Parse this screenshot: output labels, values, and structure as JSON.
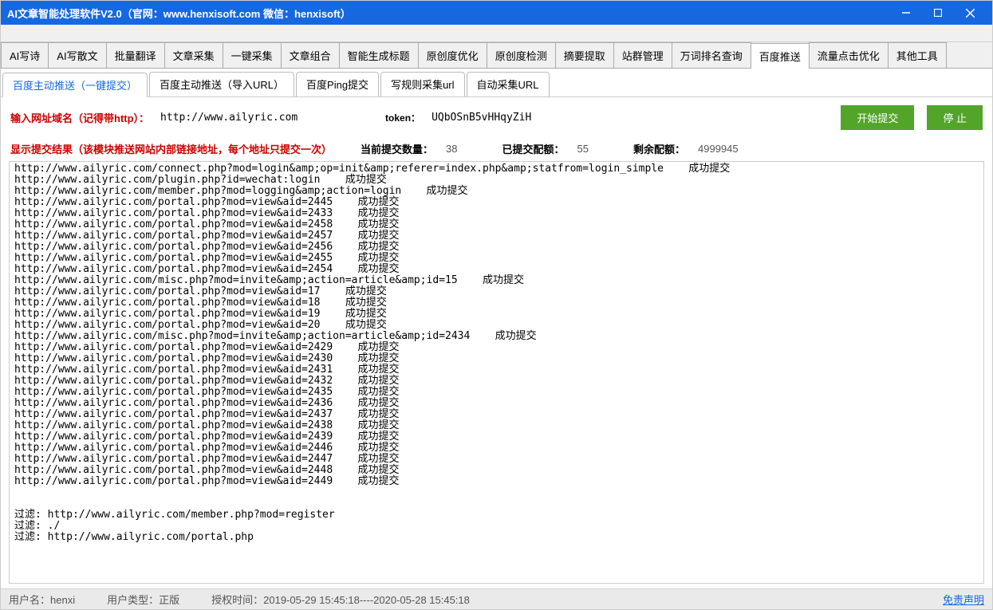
{
  "titlebar": "AI文章智能处理软件V2.0（官网：www.henxisoft.com  微信：henxisoft）",
  "mainTabs": [
    "AI写诗",
    "AI写散文",
    "批量翻译",
    "文章采集",
    "一键采集",
    "文章组合",
    "智能生成标题",
    "原创度优化",
    "原创度检测",
    "摘要提取",
    "站群管理",
    "万词排名查询",
    "百度推送",
    "流量点击优化",
    "其他工具"
  ],
  "mainTabActive": 12,
  "subTabs": [
    "百度主动推送（一键提交）",
    "百度主动推送（导入URL）",
    "百度Ping提交",
    "写规则采集url",
    "自动采集URL"
  ],
  "subTabActive": 0,
  "form": {
    "domainLabel": "输入网址域名（记得带http）：",
    "domainValue": "http://www.ailyric.com",
    "tokenLabel": "token：",
    "tokenValue": "UQbOSnB5vHHqyZiH",
    "startBtn": "开始提交",
    "stopBtn": "停  止"
  },
  "status": {
    "resultLabel": "显示提交结果（该模块推送网站内部链接地址，每个地址只提交一次）",
    "currentLabel": "当前提交数量：",
    "currentVal": "38",
    "submittedLabel": "已提交配额：",
    "submittedVal": "55",
    "remainLabel": "剩余配额：",
    "remainVal": "4999945"
  },
  "log": [
    "http://www.ailyric.com/connect.php?mod=login&amp;op=init&amp;referer=index.php&amp;statfrom=login_simple    成功提交",
    "http://www.ailyric.com/plugin.php?id=wechat:login    成功提交",
    "http://www.ailyric.com/member.php?mod=logging&amp;action=login    成功提交",
    "http://www.ailyric.com/portal.php?mod=view&aid=2445    成功提交",
    "http://www.ailyric.com/portal.php?mod=view&aid=2433    成功提交",
    "http://www.ailyric.com/portal.php?mod=view&aid=2458    成功提交",
    "http://www.ailyric.com/portal.php?mod=view&aid=2457    成功提交",
    "http://www.ailyric.com/portal.php?mod=view&aid=2456    成功提交",
    "http://www.ailyric.com/portal.php?mod=view&aid=2455    成功提交",
    "http://www.ailyric.com/portal.php?mod=view&aid=2454    成功提交",
    "http://www.ailyric.com/misc.php?mod=invite&amp;action=article&amp;id=15    成功提交",
    "http://www.ailyric.com/portal.php?mod=view&aid=17    成功提交",
    "http://www.ailyric.com/portal.php?mod=view&aid=18    成功提交",
    "http://www.ailyric.com/portal.php?mod=view&aid=19    成功提交",
    "http://www.ailyric.com/portal.php?mod=view&aid=20    成功提交",
    "http://www.ailyric.com/misc.php?mod=invite&amp;action=article&amp;id=2434    成功提交",
    "http://www.ailyric.com/portal.php?mod=view&aid=2429    成功提交",
    "http://www.ailyric.com/portal.php?mod=view&aid=2430    成功提交",
    "http://www.ailyric.com/portal.php?mod=view&aid=2431    成功提交",
    "http://www.ailyric.com/portal.php?mod=view&aid=2432    成功提交",
    "http://www.ailyric.com/portal.php?mod=view&aid=2435    成功提交",
    "http://www.ailyric.com/portal.php?mod=view&aid=2436    成功提交",
    "http://www.ailyric.com/portal.php?mod=view&aid=2437    成功提交",
    "http://www.ailyric.com/portal.php?mod=view&aid=2438    成功提交",
    "http://www.ailyric.com/portal.php?mod=view&aid=2439    成功提交",
    "http://www.ailyric.com/portal.php?mod=view&aid=2446    成功提交",
    "http://www.ailyric.com/portal.php?mod=view&aid=2447    成功提交",
    "http://www.ailyric.com/portal.php?mod=view&aid=2448    成功提交",
    "http://www.ailyric.com/portal.php?mod=view&aid=2449    成功提交",
    "",
    "",
    "过滤: http://www.ailyric.com/member.php?mod=register",
    "过滤: ./",
    "过滤: http://www.ailyric.com/portal.php"
  ],
  "statusbar": {
    "userLabel": "用户名：",
    "userVal": "henxi",
    "typeLabel": "用户类型：",
    "typeVal": "正版",
    "authLabel": "授权时间：",
    "authVal": "2019-05-29 15:45:18----2020-05-28 15:45:18",
    "disclaimer": "免责声明"
  }
}
